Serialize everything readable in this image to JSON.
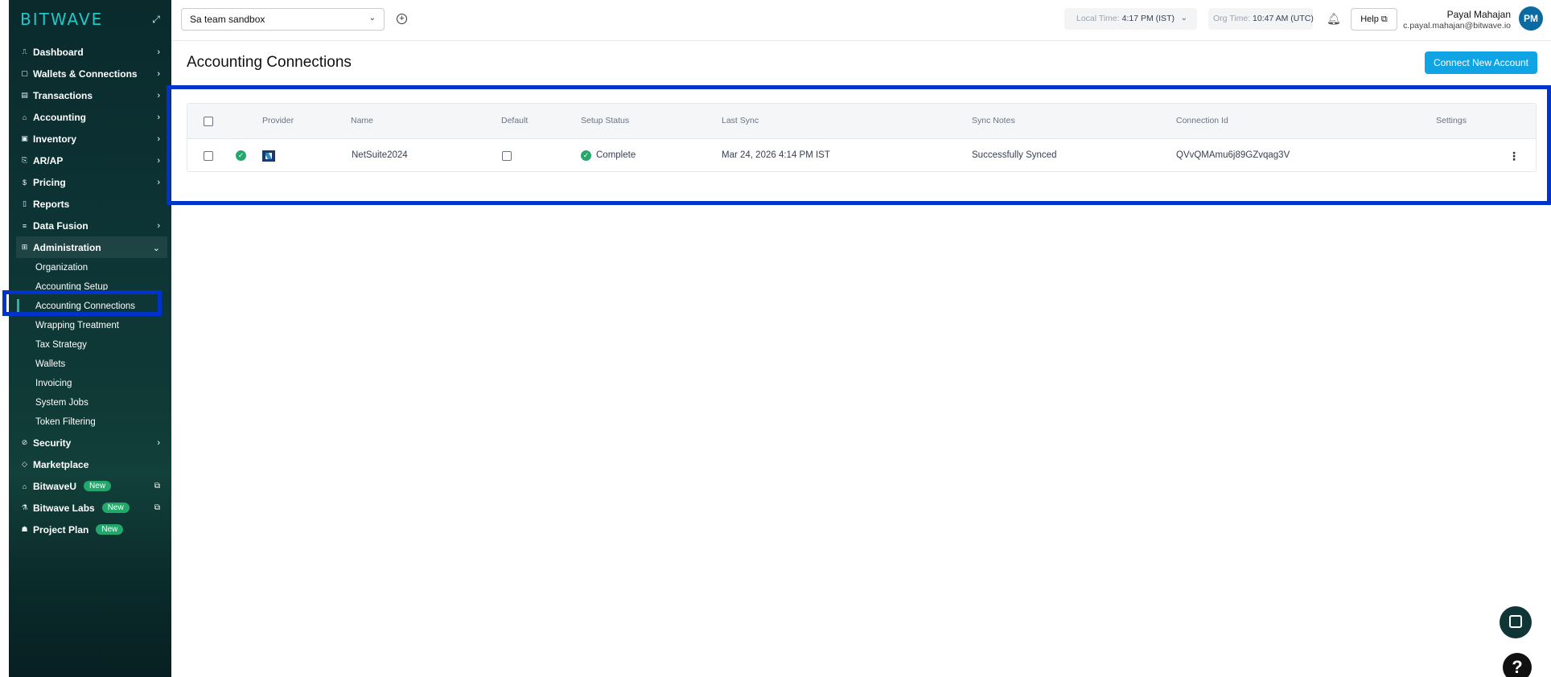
{
  "sidebar": {
    "logo": "BITWAVE",
    "items": [
      {
        "label": "Dashboard",
        "icon": "chart-line-icon",
        "glyph": "⎍"
      },
      {
        "label": "Wallets & Connections",
        "icon": "wallet-icon",
        "glyph": "▢"
      },
      {
        "label": "Transactions",
        "icon": "list-icon",
        "glyph": "▤"
      },
      {
        "label": "Accounting",
        "icon": "bank-icon",
        "glyph": "⌂"
      },
      {
        "label": "Inventory",
        "icon": "inventory-icon",
        "glyph": "▣"
      },
      {
        "label": "AR/AP",
        "icon": "invoice-icon",
        "glyph": "⎘"
      },
      {
        "label": "Pricing",
        "icon": "dollar-icon",
        "glyph": "$"
      },
      {
        "label": "Reports",
        "icon": "report-icon",
        "glyph": "▯"
      },
      {
        "label": "Data Fusion",
        "icon": "database-icon",
        "glyph": "≡"
      },
      {
        "label": "Administration",
        "icon": "admin-icon",
        "glyph": "⊞"
      }
    ],
    "admin_sub": [
      "Organization",
      "Accounting Setup",
      "Accounting Connections",
      "Wrapping Treatment",
      "Tax Strategy",
      "Wallets",
      "Invoicing",
      "System Jobs",
      "Token Filtering"
    ],
    "bottom_items": [
      {
        "label": "Security",
        "glyph": "⊘"
      },
      {
        "label": "Marketplace",
        "glyph": "◇"
      },
      {
        "label": "BitwaveU",
        "glyph": "⌂",
        "badge": "New"
      },
      {
        "label": "Bitwave Labs",
        "glyph": "⚗",
        "badge": "New"
      },
      {
        "label": "Project Plan",
        "glyph": "☗",
        "badge": "New"
      }
    ]
  },
  "topbar": {
    "org": "Sa team sandbox",
    "local_time_label": "Local Time:",
    "local_time_value": "4:17 PM (IST)",
    "org_time_label": "Org Time:",
    "org_time_value": "10:47 AM (UTC)",
    "help": "Help",
    "user_name": "Payal Mahajan",
    "user_email": "c.payal.mahajan@bitwave.io",
    "avatar": "PM"
  },
  "main": {
    "title": "Accounting Connections",
    "connect_button": "Connect New Account",
    "columns": [
      "Provider",
      "Name",
      "Default",
      "Setup Status",
      "Last Sync",
      "Sync Notes",
      "Connection Id",
      "Settings"
    ],
    "rows": [
      {
        "name": "NetSuite2024",
        "setup_status": "Complete",
        "last_sync": "Mar 24, 2026 4:14 PM IST",
        "sync_notes": "Successfully Synced",
        "connection_id": "QVvQMAmu6j89GZvqag3V"
      }
    ]
  },
  "colors": {
    "accent": "#10a4e4",
    "success": "#22a86a",
    "highlight": "#0033cc",
    "sidebar": "#0d3435"
  }
}
